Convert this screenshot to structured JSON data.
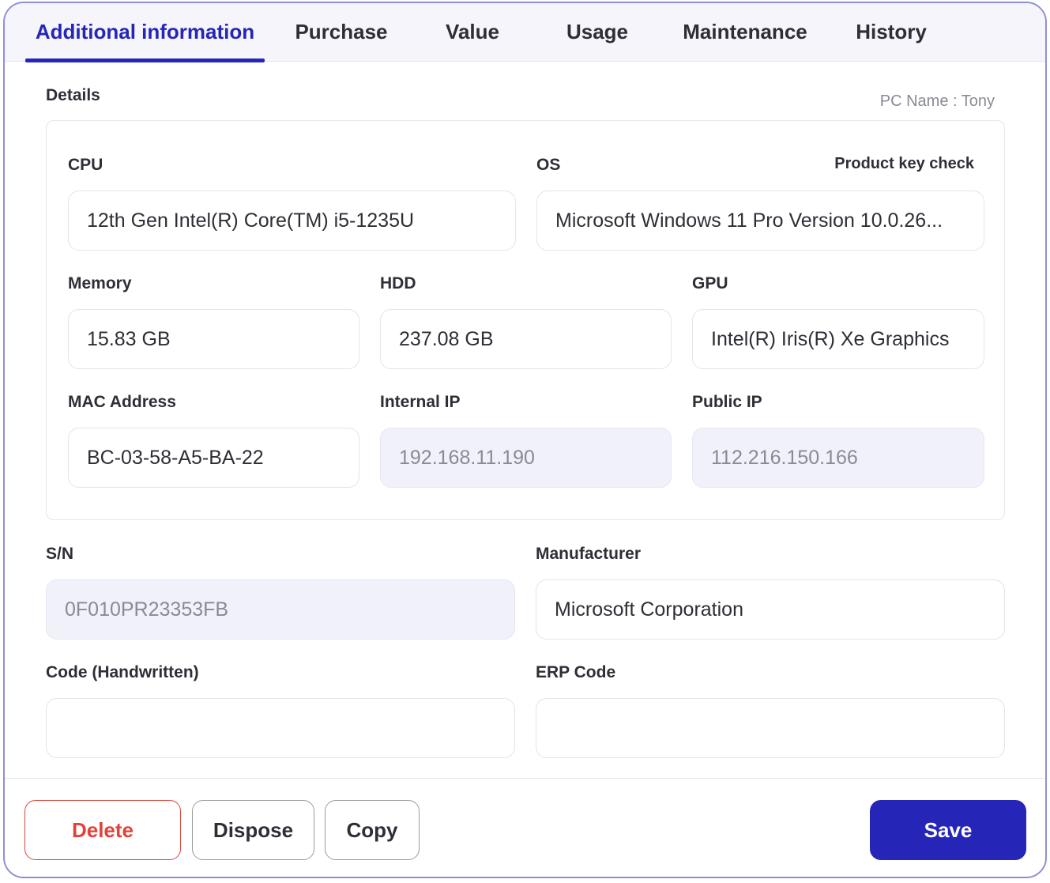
{
  "tabs": [
    {
      "label": "Additional information",
      "active": true
    },
    {
      "label": "Purchase",
      "active": false
    },
    {
      "label": "Value",
      "active": false
    },
    {
      "label": "Usage",
      "active": false
    },
    {
      "label": "Maintenance",
      "active": false
    },
    {
      "label": "History",
      "active": false
    }
  ],
  "details": {
    "title": "Details",
    "pc_name": "PC Name : Tony",
    "product_key_check": "Product key check",
    "cpu": {
      "label": "CPU",
      "value": "12th Gen Intel(R) Core(TM) i5-1235U"
    },
    "os": {
      "label": "OS",
      "value": "Microsoft Windows 11 Pro Version 10.0.26..."
    },
    "memory": {
      "label": "Memory",
      "value": "15.83 GB"
    },
    "hdd": {
      "label": "HDD",
      "value": "237.08 GB"
    },
    "gpu": {
      "label": "GPU",
      "value": "Intel(R) Iris(R) Xe Graphics"
    },
    "mac": {
      "label": "MAC Address",
      "value": "BC-03-58-A5-BA-22"
    },
    "internal_ip": {
      "label": "Internal IP",
      "value": "192.168.11.190"
    },
    "public_ip": {
      "label": "Public IP",
      "value": "112.216.150.166"
    }
  },
  "sn": {
    "label": "S/N",
    "value": "0F010PR23353FB"
  },
  "manufacturer": {
    "label": "Manufacturer",
    "value": "Microsoft Corporation"
  },
  "code_handwritten": {
    "label": "Code (Handwritten)",
    "value": ""
  },
  "erp_code": {
    "label": "ERP Code",
    "value": ""
  },
  "buttons": {
    "delete": "Delete",
    "dispose": "Dispose",
    "copy": "Copy",
    "save": "Save"
  },
  "colors": {
    "accent": "#2525b8",
    "danger": "#e0433a",
    "disabled_field": "#f1f1fa"
  }
}
